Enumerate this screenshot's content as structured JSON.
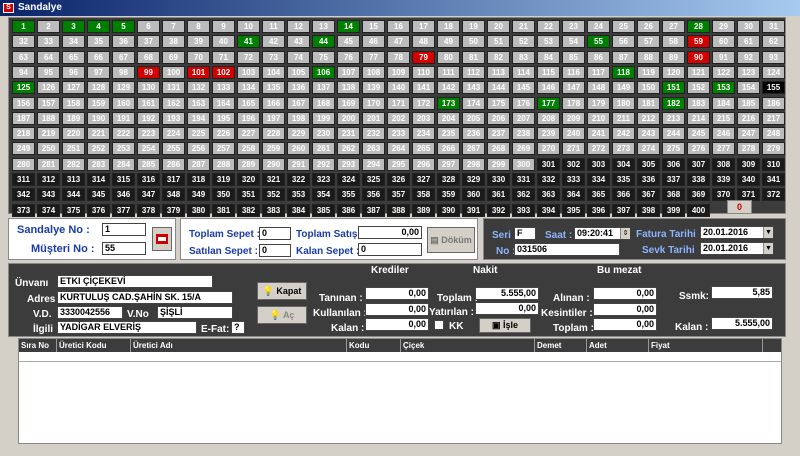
{
  "window": {
    "title": "Sandalye"
  },
  "seats": {
    "total": 400,
    "occupied": [
      1,
      3,
      4,
      5,
      41,
      44,
      55,
      118,
      125,
      151,
      153,
      173,
      177,
      182,
      14,
      28,
      106,
      106
    ],
    "reserved": [
      79,
      99,
      101,
      102,
      90,
      59
    ],
    "current": [
      155
    ],
    "disabled_from": 301
  },
  "seat_colors": {
    "occupied": "#008000",
    "reserved": "#d40000",
    "empty": "#bcbcbc",
    "disabled": "#1a1a1a"
  },
  "zero_button": "0",
  "left_box": {
    "sandalye_label": "Sandalye No :",
    "sandalye_value": "1",
    "musteri_label": "Müşteri No :",
    "musteri_value": "55"
  },
  "sepet": {
    "toplam_label": "Toplam Sepet :",
    "toplam_value": "0",
    "satilan_label": "Satılan Sepet :",
    "satilan_value": "0",
    "satis_label": "Toplam Satış:",
    "satis_value": "0,00",
    "kalan_label": "Kalan Sepet :",
    "kalan_value": "0",
    "dokum_label": "Döküm"
  },
  "fatura": {
    "seri_label": "Seri :",
    "seri_value": "F",
    "saat_label": "Saat :",
    "saat_value": "09:20:41",
    "no_label": "No :",
    "no_value": "031506",
    "fatura_tarihi_label": "Fatura Tarihi",
    "fatura_tarihi_value": "20.01.2016",
    "sevk_tarihi_label": "Sevk Tarihi",
    "sevk_tarihi_value": "20.01.2016"
  },
  "customer": {
    "unvan_label": "Ünvanı",
    "unvan_value": "ETKI ÇİÇEKEVİ",
    "adres_label": "Adres",
    "adres_value": "KURTULUŞ CAD.ŞAHİN SK. 15/A",
    "vd_label": "V.D.",
    "vd_value": "3330042556",
    "vno_label": "V.No",
    "vno_value": "ŞİŞLİ",
    "ilgili_label": "İlgili",
    "ilgili_value": "YADİGAR ELVERİŞ",
    "efat_label": "E-Fat:",
    "efat_value": "?"
  },
  "buttons": {
    "kapat": "Kapat",
    "ac": "Aç",
    "isle": "İşle"
  },
  "krediler": {
    "header": "Krediler",
    "taninan_label": "Tanınan :",
    "taninan_value": "0,00",
    "kullanilan_label": "Kullanılan :",
    "kullanilan_value": "0,00",
    "kalan_label": "Kalan :",
    "kalan_value": "0,00"
  },
  "nakit": {
    "header": "Nakit",
    "toplam_label": "Toplam :",
    "toplam_value": "5.555,00",
    "yatirilan_label": "Yatırılan :",
    "yatirilan_value": "0,00",
    "kk_label": "KK"
  },
  "bu_mezat": {
    "header": "Bu mezat",
    "alinan_label": "Alınan :",
    "alinan_value": "0,00",
    "kesintiler_label": "Kesintiler :",
    "kesintiler_value": "0,00",
    "toplam_label": "Toplam :",
    "toplam_value": "0,00"
  },
  "right": {
    "ssmk_label": "Ssmk:",
    "ssmk_value": "5,85",
    "kalan_label": "Kalan :",
    "kalan_value": "5.555,00"
  },
  "table": {
    "columns": [
      "Sıra No",
      "Üretici Kodu",
      "Üretici Adı",
      "Kodu",
      "Çiçek",
      "Demet",
      "Adet",
      "Fiyat"
    ]
  }
}
